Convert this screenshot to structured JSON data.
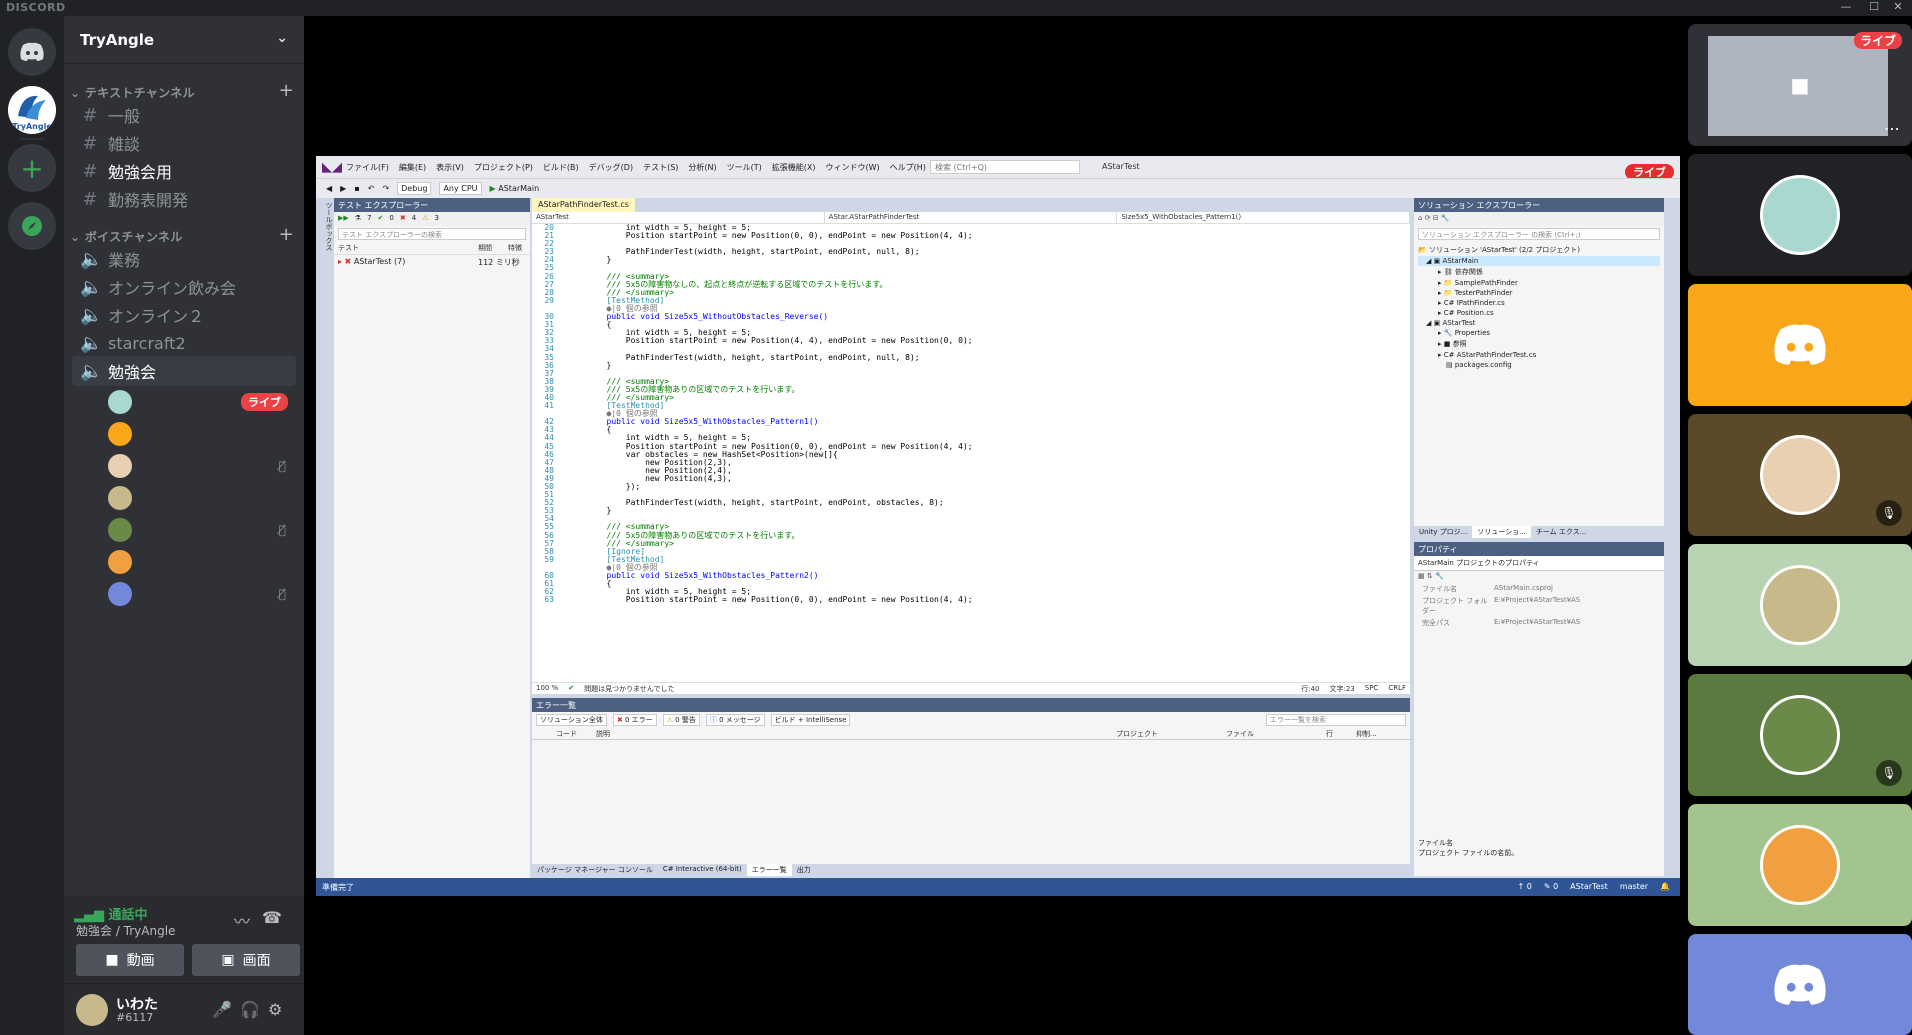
{
  "window": {
    "brand": "DISCORD",
    "minimize": "—",
    "maximize": "☐",
    "close": "✕"
  },
  "server": {
    "name": "TryAngle",
    "icon_text": "TryAngle"
  },
  "categories": {
    "text": "テキストチャンネル",
    "voice": "ボイスチャンネル"
  },
  "text_channels": [
    {
      "label": "一般"
    },
    {
      "label": "雑談"
    },
    {
      "label": "勉強会用"
    },
    {
      "label": "勤務表開発"
    }
  ],
  "voice_channels": [
    {
      "label": "業務"
    },
    {
      "label": "オンライン飲み会"
    },
    {
      "label": "オンライン２"
    },
    {
      "label": "starcraft2"
    },
    {
      "label": "勉強会"
    }
  ],
  "members_live_badge": "ライブ",
  "voice_status": {
    "status": "通話中",
    "location": "勉強会 / TryAngle",
    "video_button": "動画",
    "screen_button": "画面"
  },
  "user": {
    "name": "いわた",
    "tag": "#6117"
  },
  "vs": {
    "menus": [
      "ファイル(F)",
      "編集(E)",
      "表示(V)",
      "プロジェクト(P)",
      "ビルド(B)",
      "デバッグ(D)",
      "テスト(S)",
      "分析(N)",
      "ツール(T)",
      "拡張機能(X)",
      "ウィンドウ(W)",
      "ヘルプ(H)"
    ],
    "search_placeholder": "検索 (Ctrl+Q)",
    "project": "AStarTest",
    "live": "ライブ",
    "config": "Debug",
    "platform": "Any CPU",
    "start_target": "AStarMain",
    "test_explorer": {
      "title": "テスト エクスプローラー",
      "search": "テスト エクスプローラーの検索",
      "counts": [
        "7",
        "0",
        "4",
        "3"
      ],
      "col_test": "テスト",
      "col_duration": "期間",
      "col_trait": "特徴",
      "row_name": "AStarTest (7)",
      "row_duration": "112 ミリ秒"
    },
    "editor": {
      "tab": "AStarPathFinderTest.cs",
      "nav_project": "AStarTest",
      "nav_class": "AStar.AStarPathFinderTest",
      "nav_member": "Size5x5_WithObstacles_Pattern1()",
      "zoom": "100 %",
      "issues": "問題は見つかりませんでした",
      "pos_line": "行:40",
      "pos_char": "文字:23",
      "spc": "SPC",
      "crlf": "CRLF",
      "lines": [
        {
          "n": "20",
          "t": "            int width = 5, height = 5;",
          "k": ""
        },
        {
          "n": "21",
          "t": "            Position startPoint = new Position(0, 0), endPoint = new Position(4, 4);",
          "k": ""
        },
        {
          "n": "22",
          "t": "",
          "k": ""
        },
        {
          "n": "23",
          "t": "            PathFinderTest(width, height, startPoint, endPoint, null, 8);",
          "k": ""
        },
        {
          "n": "24",
          "t": "        }",
          "k": ""
        },
        {
          "n": "25",
          "t": "",
          "k": ""
        },
        {
          "n": "26",
          "t": "        /// <summary>",
          "k": "comment"
        },
        {
          "n": "27",
          "t": "        /// 5x5の障害物なしの、起点と終点が逆転する区域でのテストを行います。",
          "k": "comment"
        },
        {
          "n": "28",
          "t": "        /// </summary>",
          "k": "comment"
        },
        {
          "n": "29",
          "t": "        [TestMethod]",
          "k": "attr"
        },
        {
          "n": "",
          "t": "        ●|0 個の参照",
          "k": "ref"
        },
        {
          "n": "30",
          "t": "        public void Size5x5_WithoutObstacles_Reverse()",
          "k": "kw"
        },
        {
          "n": "31",
          "t": "        {",
          "k": ""
        },
        {
          "n": "32",
          "t": "            int width = 5, height = 5;",
          "k": ""
        },
        {
          "n": "33",
          "t": "            Position startPoint = new Position(4, 4), endPoint = new Position(0, 0);",
          "k": ""
        },
        {
          "n": "34",
          "t": "",
          "k": ""
        },
        {
          "n": "35",
          "t": "            PathFinderTest(width, height, startPoint, endPoint, null, 8);",
          "k": ""
        },
        {
          "n": "36",
          "t": "        }",
          "k": ""
        },
        {
          "n": "37",
          "t": "",
          "k": ""
        },
        {
          "n": "38",
          "t": "        /// <summary>",
          "k": "comment"
        },
        {
          "n": "39",
          "t": "        /// 5x5の障害物ありの区域でのテストを行います。",
          "k": "comment"
        },
        {
          "n": "40",
          "t": "        /// </summary>",
          "k": "comment"
        },
        {
          "n": "41",
          "t": "        [TestMethod]",
          "k": "attr"
        },
        {
          "n": "",
          "t": "        ●|0 個の参照",
          "k": "ref"
        },
        {
          "n": "42",
          "t": "        public void Size5x5_WithObstacles_Pattern1()",
          "k": "kw"
        },
        {
          "n": "43",
          "t": "        {",
          "k": ""
        },
        {
          "n": "44",
          "t": "            int width = 5, height = 5;",
          "k": ""
        },
        {
          "n": "45",
          "t": "            Position startPoint = new Position(0, 0), endPoint = new Position(4, 4);",
          "k": ""
        },
        {
          "n": "46",
          "t": "            var obstacles = new HashSet<Position>(new[]{",
          "k": ""
        },
        {
          "n": "47",
          "t": "                new Position(2,3),",
          "k": ""
        },
        {
          "n": "48",
          "t": "                new Position(2,4),",
          "k": ""
        },
        {
          "n": "49",
          "t": "                new Position(4,3),",
          "k": ""
        },
        {
          "n": "50",
          "t": "            });",
          "k": ""
        },
        {
          "n": "51",
          "t": "",
          "k": ""
        },
        {
          "n": "52",
          "t": "            PathFinderTest(width, height, startPoint, endPoint, obstacles, 8);",
          "k": ""
        },
        {
          "n": "53",
          "t": "        }",
          "k": ""
        },
        {
          "n": "54",
          "t": "",
          "k": ""
        },
        {
          "n": "55",
          "t": "        /// <summary>",
          "k": "comment"
        },
        {
          "n": "56",
          "t": "        /// 5x5の障害物ありの区域でのテストを行います。",
          "k": "comment"
        },
        {
          "n": "57",
          "t": "        /// </summary>",
          "k": "comment"
        },
        {
          "n": "58",
          "t": "        [Ignore]",
          "k": "attr"
        },
        {
          "n": "59",
          "t": "        [TestMethod]",
          "k": "attr"
        },
        {
          "n": "",
          "t": "        ●|0 個の参照",
          "k": "ref"
        },
        {
          "n": "60",
          "t": "        public void Size5x5_WithObstacles_Pattern2()",
          "k": "kw"
        },
        {
          "n": "61",
          "t": "        {",
          "k": ""
        },
        {
          "n": "62",
          "t": "            int width = 5, height = 5;",
          "k": ""
        },
        {
          "n": "63",
          "t": "            Position startPoint = new Position(0, 0), endPoint = new Position(4, 4);",
          "k": ""
        }
      ]
    },
    "error_list": {
      "title": "エラー一覧",
      "scope": "ソリューション全体",
      "errors": "0 エラー",
      "warnings": "0 警告",
      "messages": "0 メッセージ",
      "build": "ビルド + IntelliSense",
      "search": "エラー一覧を検索",
      "cols": [
        "コード",
        "説明",
        "プロジェクト",
        "ファイル",
        "行",
        "抑制..."
      ],
      "tabs": [
        "パッケージ マネージャー コンソール",
        "C# Interactive (64-bit)",
        "エラー一覧",
        "出力"
      ]
    },
    "solution": {
      "title": "ソリューション エクスプローラー",
      "search": "ソリューション エクスプローラー の検索 (Ctrl+;)",
      "items": [
        "ソリューション 'AStarTest' (2/2 プロジェクト)",
        "AStarMain",
        "依存関係",
        "SamplePathFinder",
        "TesterPathFinder",
        "IPathFinder.cs",
        "Position.cs",
        "AStarTest",
        "Properties",
        "参照",
        "AStarPathFinderTest.cs",
        "packages.config"
      ],
      "tabs": [
        "Unity プロジ...",
        "ソリューショ...",
        "チーム エクス..."
      ]
    },
    "properties": {
      "title": "プロパティ",
      "object": "AStarMain  プロジェクトのプロパティ",
      "rows": [
        {
          "k": "ファイル名",
          "v": "AStarMain.csproj"
        },
        {
          "k": "プロジェクト フォルダー",
          "v": "E:¥Project¥AStarTest¥AS"
        },
        {
          "k": "完全パス",
          "v": "E:¥Project¥AStarTest¥AS"
        }
      ],
      "desc_title": "ファイル名",
      "desc": "プロジェクト ファイルの名前。"
    },
    "status": {
      "ready": "準備完了",
      "up": "↑ 0",
      "edit": "✎ 0",
      "repo": "AStarTest",
      "branch": "master"
    }
  },
  "tiles": [
    {
      "bg": "#2f3136",
      "live": "ライブ"
    },
    {
      "bg": "#202225"
    },
    {
      "bg": "#faa61a"
    },
    {
      "bg": "#5a4a2a"
    },
    {
      "bg": "#b9d4b2"
    },
    {
      "bg": "#5b7a3f"
    },
    {
      "bg": "#a3c48c"
    },
    {
      "bg": "#7289da"
    }
  ]
}
